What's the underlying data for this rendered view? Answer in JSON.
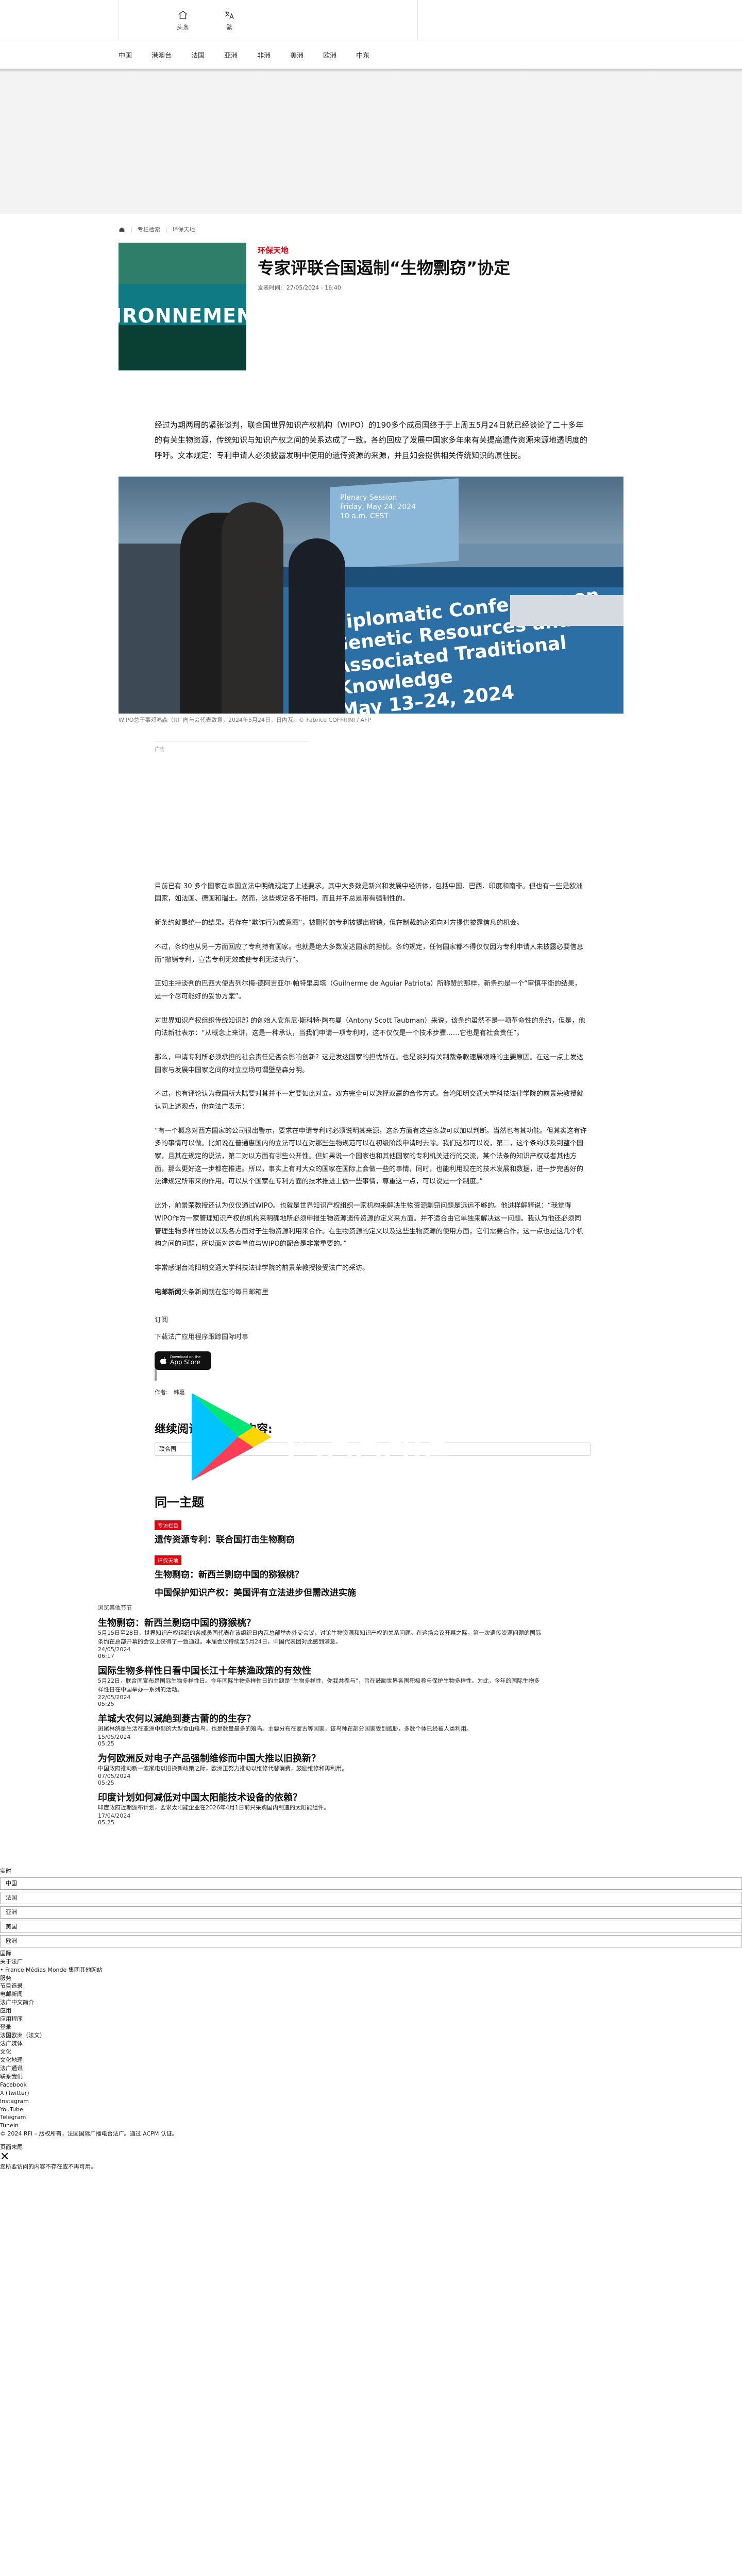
{
  "topbar": {
    "home_label": "头条",
    "lang_label": "繁"
  },
  "nav": [
    "中国",
    "港澳台",
    "法国",
    "亚洲",
    "非洲",
    "美洲",
    "欧洲",
    "中东"
  ],
  "breadcrumb": [
    "专栏检索",
    "环保天地"
  ],
  "article": {
    "thumb_word": "IRONNEMENT",
    "kicker": "环保天地",
    "title": "专家评联合国遏制“生物剽窃”协定",
    "pub_label": "发表时间:",
    "pub_date": "27/05/2024 - 16:40",
    "lead": "经过为期两周的紧张谈判，联合国世界知识产权机构（WIPO）的190多个成员国终于于上周五5月24日就已经谈论了二十多年的有关生物资源，传统知识与知识产权之间的关系达成了一致。各约回应了发展中国家多年来有关提高遗传资源来源地透明度的呼吁。文本规定：专利申请人必须披露发明中使用的遗传资源的来源，并且如会提供相关传统知识的原住民。",
    "photo_screen": "Plenary Session\nFriday, May 24, 2024\n10 a.m. CEST",
    "photo_banner": "Diplomatic Conference on\nGenetic Resources and\nAssociated Traditional\nKnowledge\nMay 13–24, 2024",
    "photo_caption": "WIPO总干事邓鸿森（R）向与会代表致意，2024年5月24日，日内瓦。© Fabrice COFFRINI / AFP",
    "ad_label": "广告",
    "paragraphs": [
      "目前已有 30 多个国家在本国立法中明确规定了上述要求。其中大多数是新兴和发展中经济体，包括中国、巴西、印度和南非。但也有一些是欧洲国家，如法国、德国和瑞士。然而，这些规定各不相同，而且并不总是带有强制性的。",
      "新条约就是统一的结果。若存在“欺诈行为或意图”，被删掉的专利被提出撤销，但在制裁的必须向对方提供披露信息的机会。",
      "不过，条约也从另一方面回应了专利持有国家。也就是绝大多数发达国家的担忧。条约规定，任何国家都不得仅仅因为专利申请人未披露必要信息而“撤销专利，宣告专利无效或使专利无法执行”。",
      "正如主持谈判的巴西大使吉列尔梅·德阿吉亚尔·帕特里奥塔（Guilherme de Aguiar Patriota）所称赞的那样，新条约是一个“审慎平衡的结果，是一个尽可能好的妥协方案”。",
      "对世界知识产权组织传统知识部 的创始人安东尼·斯科特·陶布曼（Antony Scott Taubman）来说，该条约虽然不是一项革命性的条约，但是，他向法新社表示：“从概念上来讲，这是一种承认，当我们申请一项专利时，这不仅仅是一个技术步骤……它也是有社会责任”。",
      "那么，申请专利所必须承担的社会责任是否会影响创新？这是发达国家的担忧所在。也是谈判有关制裁条款速展艰难的主要原因。在这一点上发达国家与发展中国家之间的对立立场可谓壁垒森分明。",
      "不过，也有评论认为我国所大陆要对其并不一定要如此对立。双方完全可以选择双赢的合作方式。台湾阳明交通大学科技法律学院的前景荣教授就认同上述观点，他向法广表示：",
      "“有一个概念对西方国家的公司很出警示，要求在申请专利时必须说明其来源，这条方面有这些条款可以加以判断。当然也有其功能。但其实这有许多的事情可以做。比如说在普通惠国内的立法可以在对那些生物规范可以在初级阶段申请时去除。我们这都可以说，第二，这个条约涉及到整个国家，且其在规定的说法，第二对以方面有哪些公开性。但如果说一个国家也和其他国家的专利机关进行的交流，某个法条的知识产权或者其他方面，那么更好这一步都在推进。所以，事实上有时大众的国家在国际上会做一些的事情，同时，也能利用现在的技术发展和数据，进一步完善好的法律规定所带来的作用。可以从个国家在专利方面的技术推进上做一些事情，尊重这一点，可以说是一个制度。”",
      "此外，前景荣教授还认为仅仅通过WIPO。也就是世界知识产权组织一家机构来解决生物资源剽窃问题是远远不够的。他进样解释说：“我觉得WIPO作为一家管理知识产权的机构来明确地所必须申报生物资源遗传资源的定义来方面。并不适合由它单独来解决这一问题。我认为他还必须同管理生物多样性协议以及各方面对于生物资源利用来合作。在生物资源的定义以及这些生物资源的使用方面，它们需要合作，这一点也是这几个机构之间的问题，所以面对这些单位与WIPO的配合是非常重要的。”",
      "非常感谢台湾阳明交通大学科技法律学院的前景荣教授接受法广的采访。"
    ],
    "paragraph_strong": "电邮新闻",
    "paragraph_tail": "头条新闻就在您的每日邮箱里",
    "subscribe": "订阅",
    "download": "下载法广应用程序跟踪国际时事",
    "appstore_small": "Download on the",
    "appstore_big": "App Store",
    "gplay_top": "下载应用，请到",
    "gplay_bottom": "Google Play",
    "author": "作者:　韩嘉"
  },
  "related": {
    "heading": "继续阅读相关主题内容:",
    "tag": "联合国"
  },
  "same_topic": {
    "heading": "同一主题",
    "items": [
      {
        "badge": "专访栏目",
        "title": "遗传资源专利：联合国打击生物剽窃"
      },
      {
        "badge": "环保天地",
        "title": "生物剽窃：新西兰剽窃中国的猕猴桃？"
      },
      {
        "badge": "中国知识产权：美国评有立法进步但需改进实施",
        "title": "中国保护知识产权：美国评有立法进步但需改进实施"
      }
    ]
  },
  "digest": {
    "label": "浏览其他节节",
    "items": [
      {
        "h": "生物剽窃：新西兰剽窃中国的猕猴桃？",
        "p": "5月15日至28日，世界知识产权组织的各成员国代表在该组织日内瓦总部举办外交会议，讨论生物资源和知识产权的关系问题。在这场会议开幕之际，第一次遗传资源问题的国际条约在总部开幕的会议上获得了一致通过。本届会议持续至5月24日，中国代表团对此感到满意。",
        "dt": "24/05/2024\n06:17"
      },
      {
        "h": "国际生物多样性日看中国长江十年禁渔政策的有效性",
        "p": "5月22日，联合国宣布是国际生物多样性日。今年国际生物多样性日的主题是“生物多样性，你我共参与”，旨在鼓励世界各国积极参与保护生物多样性。为此，今年的国际生物多样性日在中国举办一系列的活动。",
        "dt": "22/05/2024\n05:25"
      },
      {
        "h": "羊城大农何以滅絶到菱古蕾的的生存？",
        "p": "斑尾林鸽是生活在亚洲中部的大型食山雉鸟，也是数量最多的雉鸟。主要分布在蒙古等国家，该鸟种在部分国家受到威胁，多数个体已经被人类利用。",
        "dt": "15/05/2024\n05:25"
      },
      {
        "h": "为何欧洲反对电子产品强制维修而中国大推以旧换新？",
        "p": "中国政府推动新一波家电以旧换新政策之际，欧洲正努力推动以维修代替消费，鼓励维修和再利用。",
        "dt": "07/05/2024\n05:25"
      },
      {
        "h": "印度计划如何减低对中国太阳能技术设备的依赖？",
        "p": "印度政府近期颁布计划，要求太阳能企业在2026年4月1日前只采购国内制造的太阳能组件。",
        "dt": "17/04/2024\n05:25"
      }
    ]
  },
  "footer": {
    "lines": [
      "实时",
      "中国",
      "法国",
      "亚洲",
      "美国",
      "非洲",
      "欧洲",
      "中东",
      "国际",
      "港澳台",
      "科技与文化",
      "关于法广",
      "• France Médias Monde 集团其他网站",
      "服务",
      "节目选录",
      "电邮新闻",
      "法广中文简介",
      "应用",
      "应用程序",
      "登录",
      "法国欧洲（法文）",
      "法广媒体",
      "文化",
      "文化地理",
      "法广通讯",
      "联系我们",
      "Facebook",
      "X (Twitter)",
      "Instagram",
      "YouTube",
      "Telegram",
      "TuneIn",
      "© 2024 RFI – 版权所有，法国国际广播电台法广。通过 ACPM 认证。",
      "页面末尾",
      "您所要访问的内容不存在或不再可用。"
    ],
    "field_items": [
      "中国",
      "法国",
      "亚洲",
      "美国",
      "欧洲"
    ]
  }
}
